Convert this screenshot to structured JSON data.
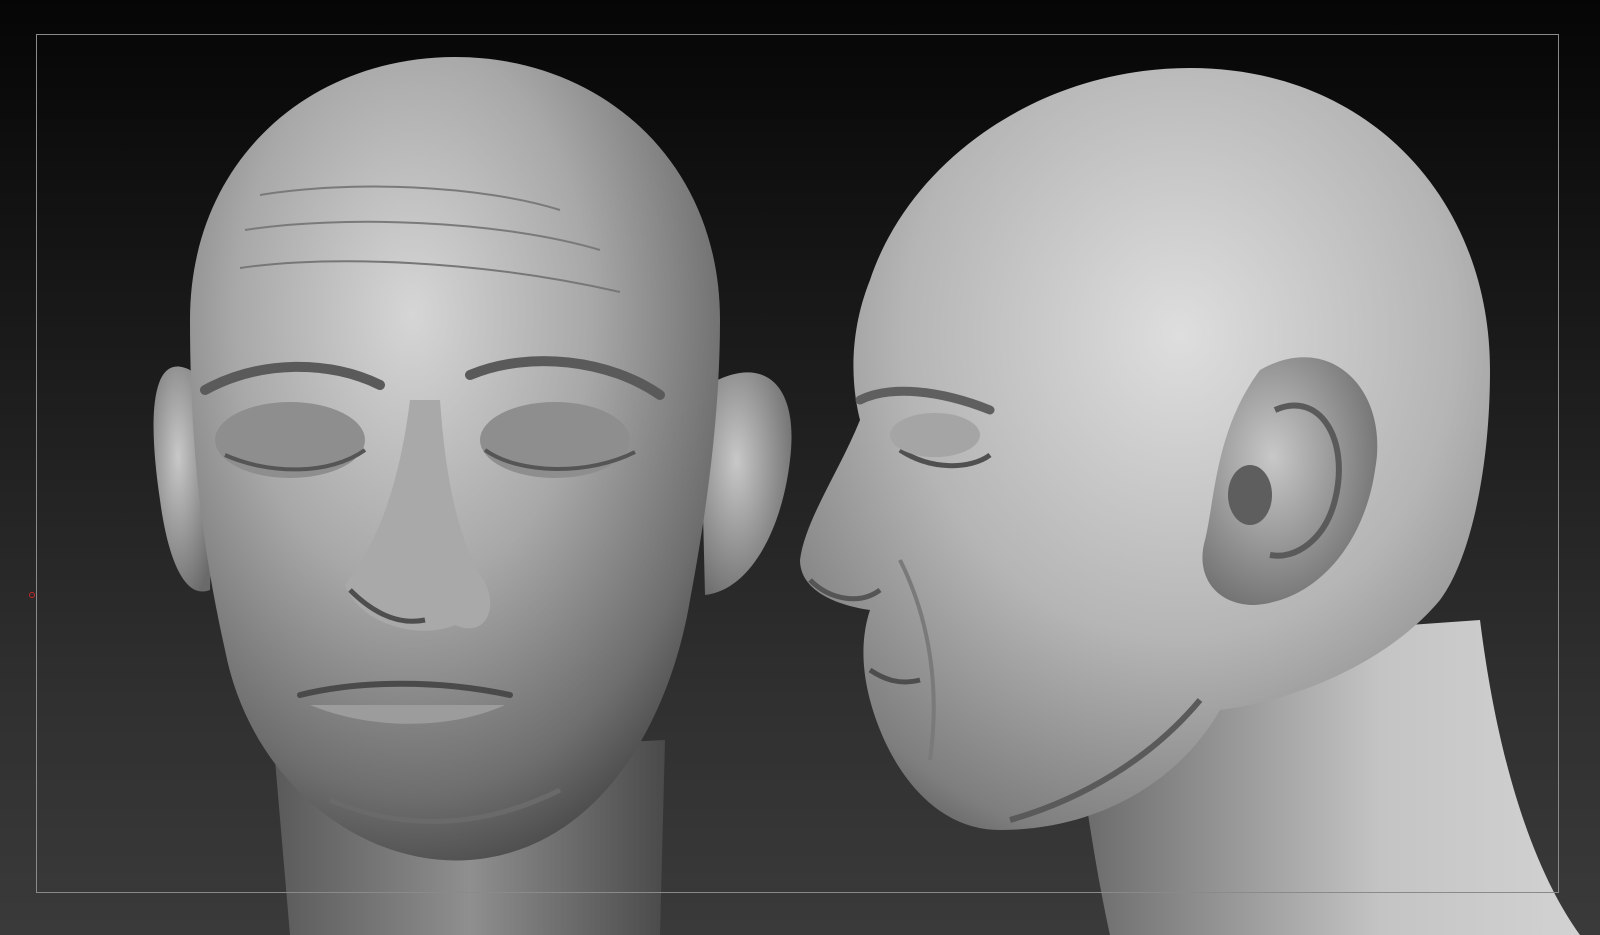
{
  "viewport": {
    "background_top": "#050505",
    "background_bottom": "#3a3a3a",
    "frame_color": "#8a8a8a",
    "cursor_color": "#c62828"
  },
  "models": [
    {
      "name": "front-view-bust",
      "view": "front",
      "material": "#9a9a9a"
    },
    {
      "name": "side-view-bust",
      "view": "profile",
      "material": "#b0b0b0"
    }
  ]
}
